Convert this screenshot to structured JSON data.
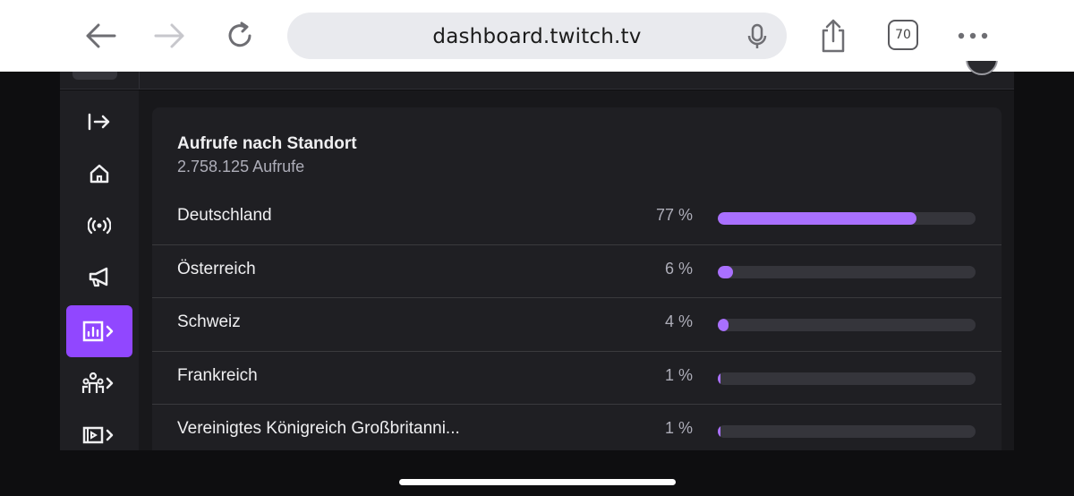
{
  "browser": {
    "url": "dashboard.twitch.tv",
    "tab_count": "70"
  },
  "card": {
    "title": "Aufrufe nach Standort",
    "subtitle": "2.758.125 Aufrufe",
    "rows": [
      {
        "name": "Deutschland",
        "percent_label": "77 %",
        "percent": 77
      },
      {
        "name": "Österreich",
        "percent_label": "6 %",
        "percent": 6
      },
      {
        "name": "Schweiz",
        "percent_label": "4 %",
        "percent": 4
      },
      {
        "name": "Frankreich",
        "percent_label": "1 %",
        "percent": 1
      },
      {
        "name": "Vereinigtes Königreich Großbritanni...",
        "percent_label": "1 %",
        "percent": 1
      }
    ]
  },
  "colors": {
    "accent": "#9147ff",
    "bar_fill": "#a970ff"
  },
  "sidebar": {
    "items": [
      {
        "icon": "collapse-arrow-icon"
      },
      {
        "icon": "home-icon"
      },
      {
        "icon": "broadcast-icon"
      },
      {
        "icon": "megaphone-icon"
      },
      {
        "icon": "analytics-icon",
        "active": true
      },
      {
        "icon": "community-icon"
      },
      {
        "icon": "content-icon"
      }
    ]
  }
}
